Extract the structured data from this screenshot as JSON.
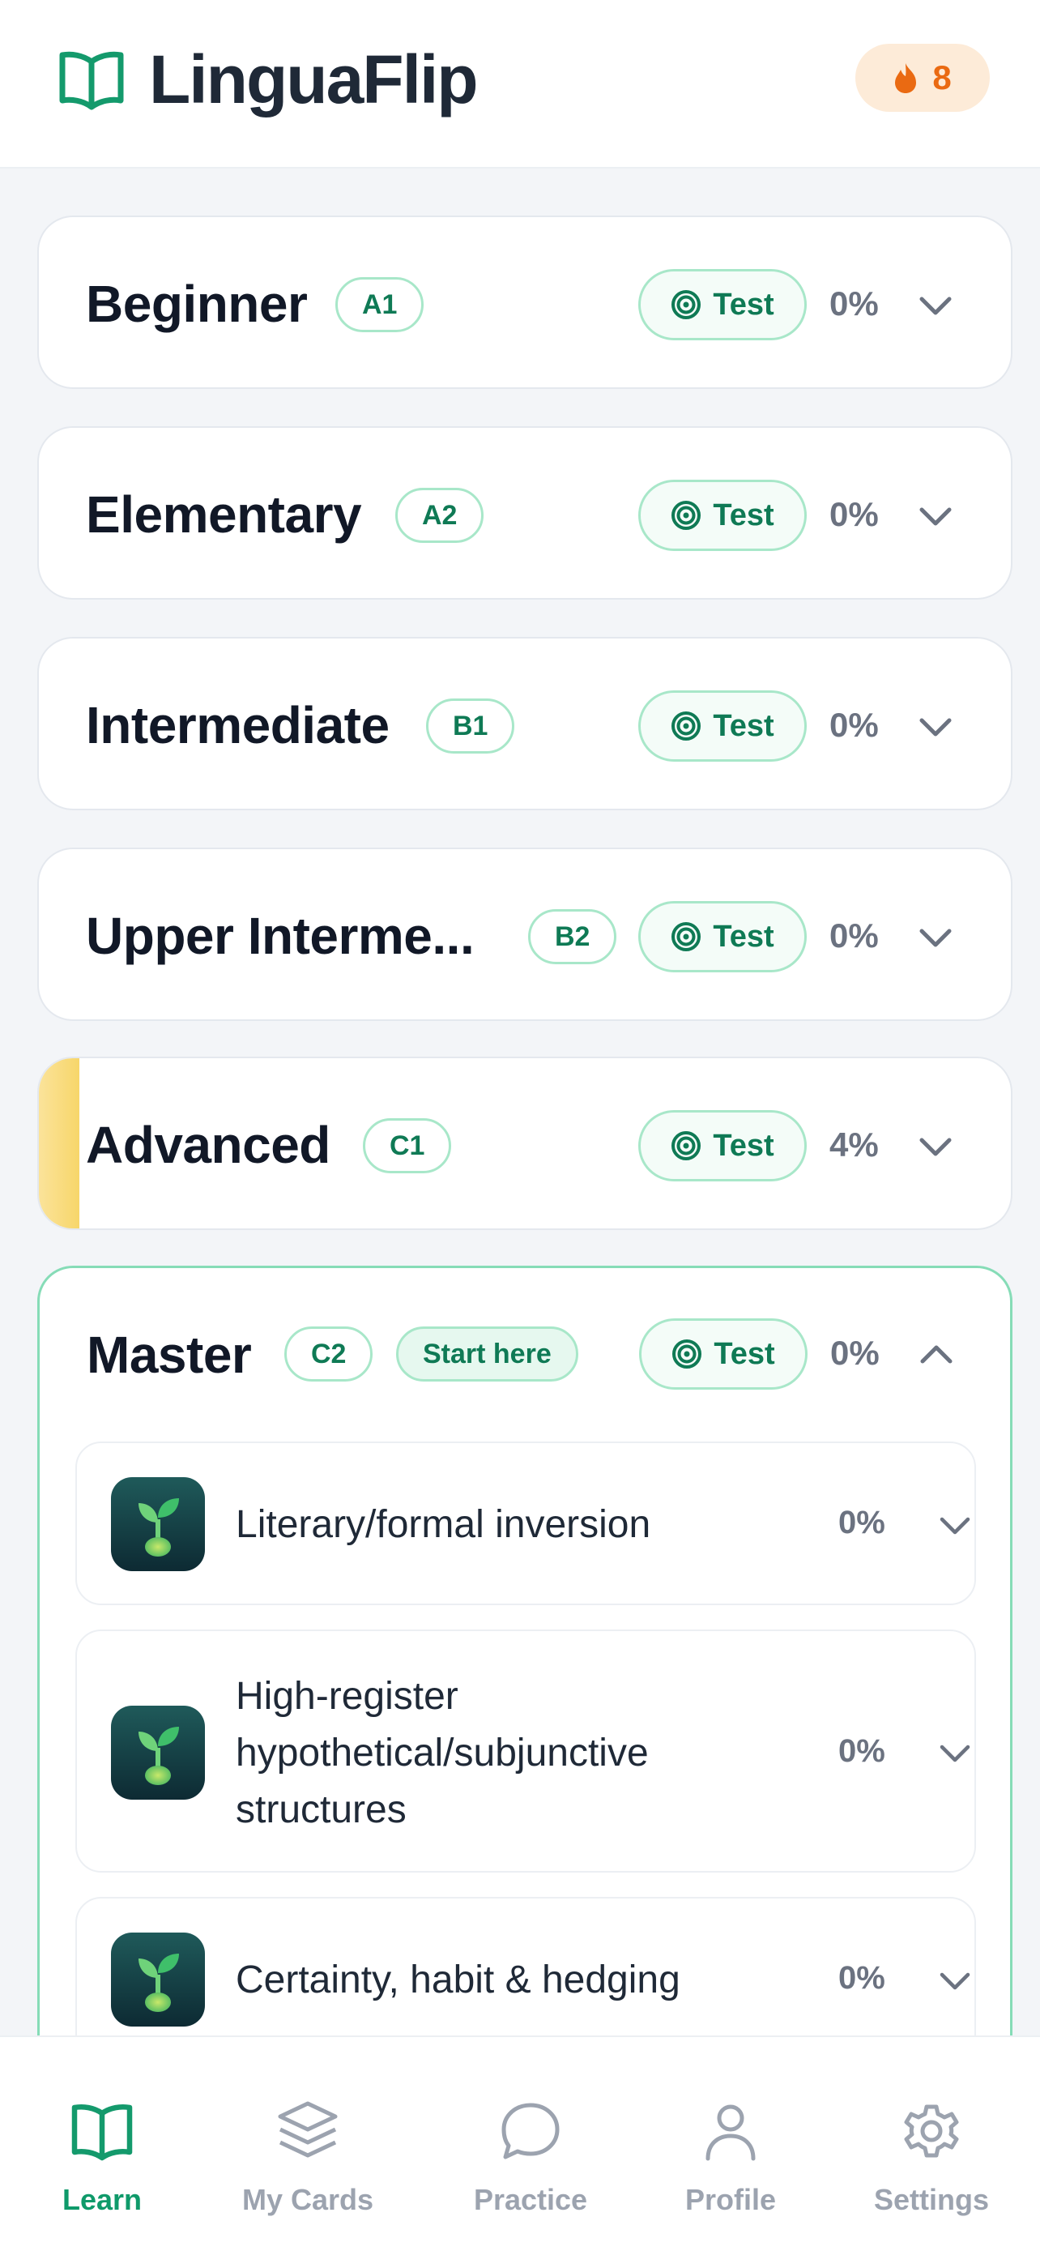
{
  "app": {
    "title": "LinguaFlip",
    "streak_count": "8",
    "brand_color": "#149a6c",
    "streak_color": "#ea6a12"
  },
  "levels": [
    {
      "title": "Beginner",
      "cefr": "A1",
      "test_label": "Test",
      "progress": "0%",
      "expanded": false
    },
    {
      "title": "Elementary",
      "cefr": "A2",
      "test_label": "Test",
      "progress": "0%",
      "expanded": false
    },
    {
      "title": "Intermediate",
      "cefr": "B1",
      "test_label": "Test",
      "progress": "0%",
      "expanded": false
    },
    {
      "title": "Upper Interme...",
      "cefr": "B2",
      "test_label": "Test",
      "progress": "0%",
      "expanded": false
    },
    {
      "title": "Advanced",
      "cefr": "C1",
      "test_label": "Test",
      "progress": "4%",
      "expanded": false
    },
    {
      "title": "Master",
      "cefr": "C2",
      "badge": "Start here",
      "test_label": "Test",
      "progress": "0%",
      "expanded": true
    }
  ],
  "master_topics": [
    {
      "title": "Literary/formal inversion",
      "progress": "0%",
      "icon": "sprout-icon"
    },
    {
      "title": "High-register hypothetical/subjunctive structures",
      "progress": "0%",
      "icon": "sprout-icon"
    },
    {
      "title": "Certainty, habit & hedging",
      "progress": "0%",
      "icon": "sprout-icon"
    }
  ],
  "nav": [
    {
      "label": "Learn",
      "icon": "book-icon",
      "active": true
    },
    {
      "label": "My Cards",
      "icon": "layers-icon",
      "active": false
    },
    {
      "label": "Practice",
      "icon": "chat-bubble-icon",
      "active": false
    },
    {
      "label": "Profile",
      "icon": "user-icon",
      "active": false
    },
    {
      "label": "Settings",
      "icon": "gear-icon",
      "active": false
    }
  ]
}
